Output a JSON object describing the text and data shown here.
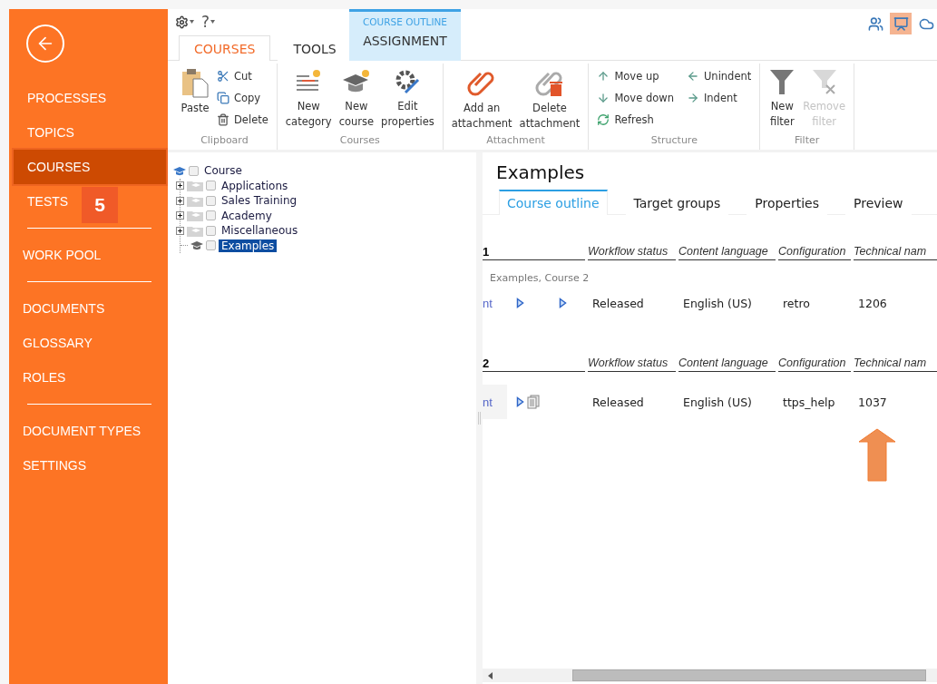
{
  "sidebar": {
    "groups": [
      {
        "items": [
          {
            "label": "PROCESSES",
            "selected": false
          },
          {
            "label": "TOPICS",
            "selected": false
          },
          {
            "label": "COURSES",
            "selected": true
          },
          {
            "label": "TESTS",
            "selected": false,
            "badge": "5"
          }
        ]
      },
      {
        "items": [
          {
            "label": "WORK POOL",
            "selected": false
          }
        ]
      },
      {
        "items": [
          {
            "label": "DOCUMENTS",
            "selected": false
          },
          {
            "label": "GLOSSARY",
            "selected": false
          },
          {
            "label": "ROLES",
            "selected": false
          }
        ]
      },
      {
        "items": [
          {
            "label": "DOCUMENT TYPES",
            "selected": false
          },
          {
            "label": "SETTINGS",
            "selected": false
          }
        ]
      }
    ]
  },
  "quick_toolbar": {
    "help": "?"
  },
  "ribbon_tabs": [
    {
      "label": "COURSES",
      "selected": true,
      "kind": "plain"
    },
    {
      "label": "TOOLS",
      "selected": false,
      "kind": "plain"
    },
    {
      "label": "ASSIGNMENT",
      "selected": false,
      "kind": "contextual",
      "context": "COURSE OUTLINE"
    }
  ],
  "view_switcher": [
    {
      "selected": false
    },
    {
      "selected": true
    },
    {
      "selected": false
    }
  ],
  "ribbon_groups": [
    {
      "label": "Clipboard",
      "buttons": [
        {
          "lines": [
            "Paste"
          ],
          "kind": "large",
          "disabled": false
        },
        {
          "lines": [
            "Cut"
          ],
          "kind": "small",
          "disabled": false
        },
        {
          "lines": [
            "Copy"
          ],
          "kind": "small",
          "disabled": false
        },
        {
          "lines": [
            "Delete"
          ],
          "kind": "small",
          "disabled": false
        }
      ]
    },
    {
      "label": "Courses",
      "buttons": [
        {
          "lines": [
            "New",
            "category"
          ],
          "kind": "large",
          "disabled": false
        },
        {
          "lines": [
            "New",
            "course"
          ],
          "kind": "large",
          "disabled": false
        },
        {
          "lines": [
            "Edit",
            "properties"
          ],
          "kind": "large",
          "disabled": false
        }
      ]
    },
    {
      "label": "Attachment",
      "buttons": [
        {
          "lines": [
            "Add an",
            "attachment"
          ],
          "kind": "large",
          "disabled": false
        },
        {
          "lines": [
            "Delete",
            "attachment"
          ],
          "kind": "large",
          "disabled": false
        }
      ]
    },
    {
      "label": "Structure",
      "buttons": [
        {
          "lines": [
            "Move up"
          ],
          "kind": "small",
          "disabled": false
        },
        {
          "lines": [
            "Move down"
          ],
          "kind": "small",
          "disabled": false
        },
        {
          "lines": [
            "Refresh"
          ],
          "kind": "small",
          "disabled": false
        },
        {
          "lines": [
            "Unindent"
          ],
          "kind": "small",
          "disabled": false
        },
        {
          "lines": [
            "Indent"
          ],
          "kind": "small",
          "disabled": false
        }
      ]
    },
    {
      "label": "Filter",
      "buttons": [
        {
          "lines": [
            "New",
            "filter"
          ],
          "kind": "large",
          "disabled": false
        },
        {
          "lines": [
            "Remove",
            "filter"
          ],
          "kind": "large",
          "disabled": true
        }
      ]
    }
  ],
  "tree": {
    "label": "Course",
    "checked": false,
    "children": [
      {
        "label": "Applications",
        "kind": "folder",
        "checked": false,
        "expanded": false,
        "selected": false
      },
      {
        "label": "Sales Training",
        "kind": "folder",
        "checked": false,
        "expanded": false,
        "selected": false
      },
      {
        "label": "Academy",
        "kind": "folder",
        "checked": false,
        "expanded": false,
        "selected": false
      },
      {
        "label": "Miscellaneous",
        "kind": "folder",
        "checked": false,
        "expanded": false,
        "selected": false
      },
      {
        "label": "Examples",
        "kind": "course",
        "checked": false,
        "selected": true
      }
    ]
  },
  "detail": {
    "title": "Examples",
    "tabs": [
      {
        "label": "Course outline",
        "selected": true
      },
      {
        "label": "Target groups",
        "selected": false
      },
      {
        "label": "Properties",
        "selected": false
      },
      {
        "label": "Preview",
        "selected": false
      }
    ],
    "sections": [
      {
        "number": "1",
        "columns": [
          "Workflow status",
          "Content language",
          "Configuration",
          "Technical nam"
        ],
        "caption": "Examples, Course 2",
        "row": {
          "lead": "nt",
          "cells": [
            "Released",
            "English (US)",
            "retro",
            "1206"
          ]
        }
      },
      {
        "number": "2",
        "columns": [
          "Workflow status",
          "Content language",
          "Configuration",
          "Technical nam"
        ],
        "row": {
          "lead": "nt",
          "cells": [
            "Released",
            "English (US)",
            "ttps_help",
            "1037"
          ]
        }
      }
    ]
  }
}
